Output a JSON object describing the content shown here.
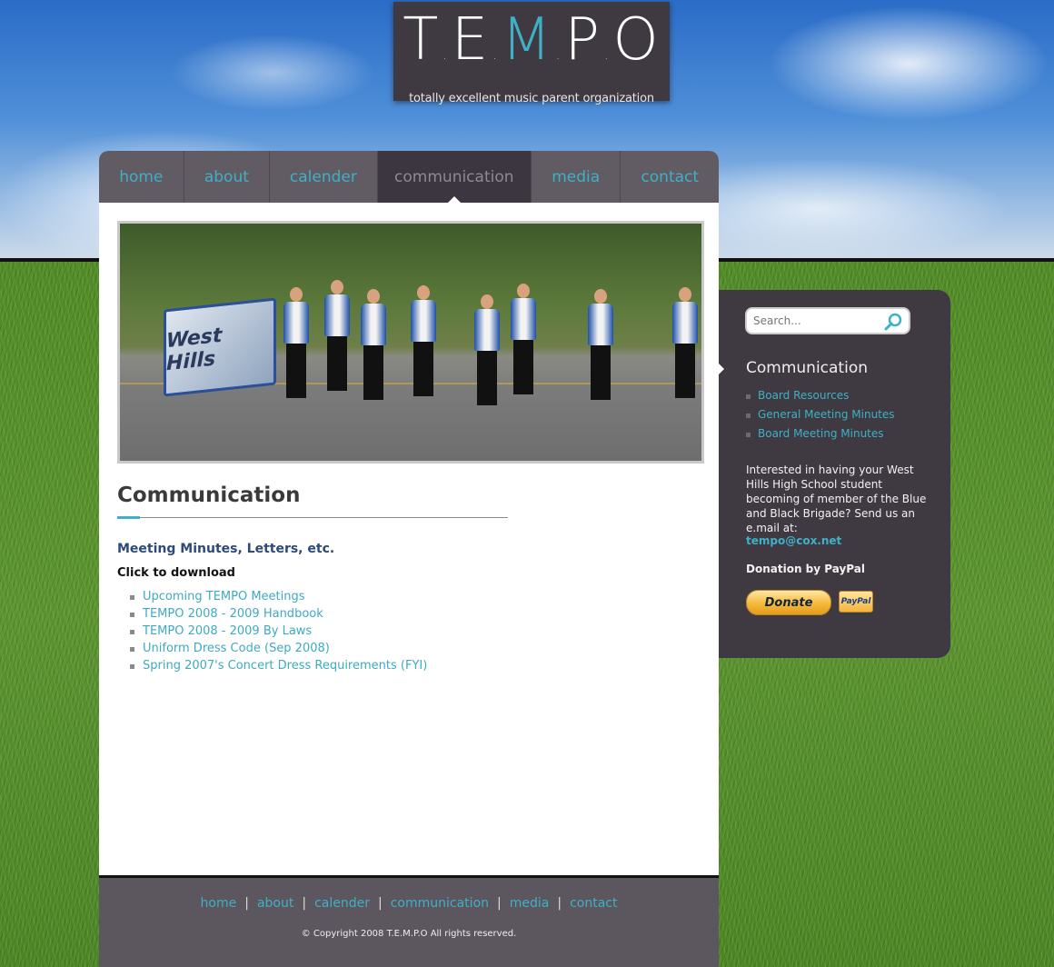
{
  "logo": {
    "letters": [
      "T",
      "E",
      "M",
      "P",
      "O"
    ],
    "tagline": "totally excellent music parent organization"
  },
  "nav": {
    "items": [
      {
        "label": "home"
      },
      {
        "label": "about"
      },
      {
        "label": "calender"
      },
      {
        "label": "communication"
      },
      {
        "label": "media"
      },
      {
        "label": "contact"
      }
    ],
    "active": "communication"
  },
  "hero": {
    "flag_text": "West Hills"
  },
  "main": {
    "title": "Communication",
    "subhead": "Meeting Minutes, Letters, etc.",
    "click_label": "Click to download",
    "downloads": [
      "Upcoming TEMPO Meetings",
      "TEMPO 2008 - 2009 Handbook",
      "TEMPO 2008 - 2009 By Laws",
      "Uniform Dress Code (Sep 2008)",
      "Spring 2007's Concert Dress Requirements (FYI)"
    ]
  },
  "footer": {
    "links": [
      "home",
      "about",
      "calender",
      "communication",
      "media",
      "contact"
    ],
    "copyright": "© Copyright 2008 T.E.M.P.O All rights reserved."
  },
  "sidebar": {
    "search_placeholder": "Search...",
    "title": "Communication",
    "links": [
      "Board Resources",
      "General Meeting Minutes",
      "Board Meeting Minutes"
    ],
    "info_text": "Interested in having your West Hills High School student becoming of member of the Blue and Black Brigade? Send us an e.mail at:",
    "email": "tempo@cox.net",
    "donation_label": "Donation by PayPal",
    "donate_button": "Donate",
    "paypal_badge": "PayPal"
  },
  "colors": {
    "accent": "#3fb0c6",
    "panel_dark": "#3f3a42",
    "nav_bg": "#615b63"
  }
}
